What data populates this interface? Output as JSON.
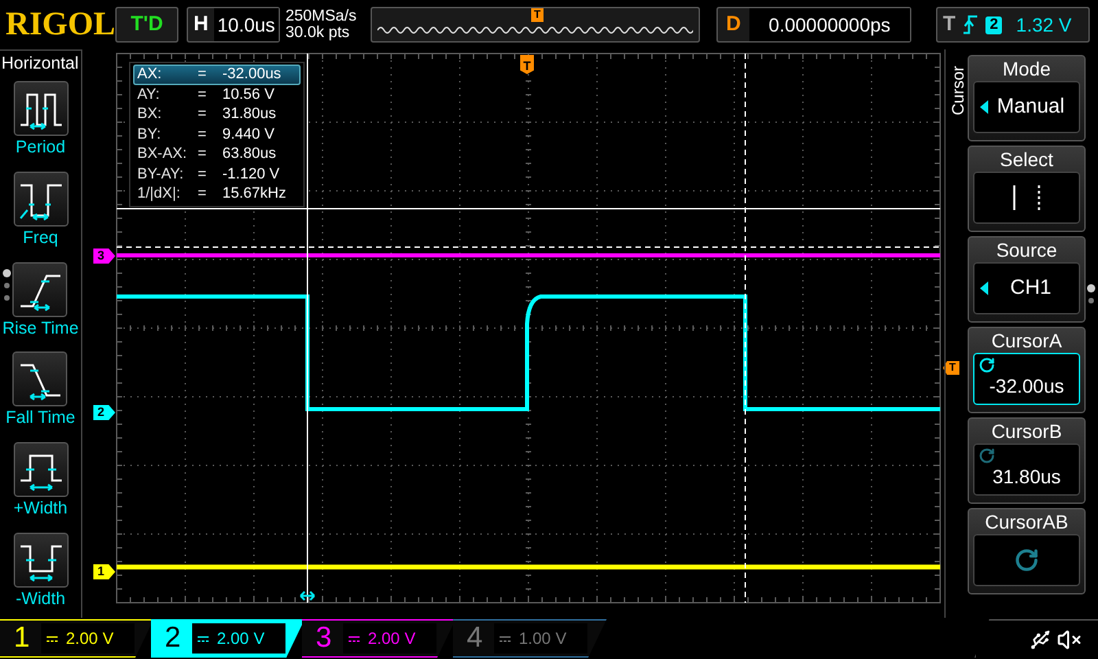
{
  "logo": "RIGOL",
  "run_status": "T'D",
  "horizontal": {
    "label": "H",
    "timebase": "10.0us"
  },
  "acquisition": {
    "sample_rate": "250MSa/s",
    "memory_depth": "30.0k pts"
  },
  "overview": {
    "trigger_marker": "T"
  },
  "delay": {
    "label": "D",
    "value": "0.00000000ps"
  },
  "trigger": {
    "label": "T",
    "source": "2",
    "level": "1.32 V"
  },
  "left_menu": {
    "title": "Horizontal",
    "items": [
      {
        "kind": "period",
        "label": "Period"
      },
      {
        "kind": "freq",
        "label": "Freq"
      },
      {
        "kind": "rise",
        "label": "Rise Time"
      },
      {
        "kind": "fall",
        "label": "Fall Time"
      },
      {
        "kind": "pwidth",
        "label": "+Width"
      },
      {
        "kind": "nwidth",
        "label": "-Width"
      }
    ]
  },
  "cursor_readout": [
    {
      "label": "AX:",
      "separator": "=",
      "value": "-32.00us",
      "selected": true
    },
    {
      "label": "AY:",
      "separator": "=",
      "value": "10.56 V",
      "selected": false
    },
    {
      "label": "BX:",
      "separator": "=",
      "value": "31.80us",
      "selected": false
    },
    {
      "label": "BY:",
      "separator": "=",
      "value": "9.440 V",
      "selected": false
    },
    {
      "label": "BX-AX:",
      "separator": "=",
      "value": "63.80us",
      "selected": false
    },
    {
      "label": "BY-AY:",
      "separator": "=",
      "value": "-1.120 V",
      "selected": false
    },
    {
      "label": "1/|dX|:",
      "separator": "=",
      "value": "15.67kHz",
      "selected": false
    }
  ],
  "trigger_markers": {
    "top": "T",
    "level": "T"
  },
  "channel_markers": [
    {
      "label": "3",
      "color": "#ff00ff"
    },
    {
      "label": "2",
      "color": "#00ffff"
    },
    {
      "label": "1",
      "color": "#ffff00"
    }
  ],
  "right_menu": {
    "title": "Cursor",
    "items": [
      {
        "kind": "dropdown",
        "title": "Mode",
        "value": "Manual",
        "selected": false
      },
      {
        "kind": "select",
        "title": "Select",
        "selected": false
      },
      {
        "kind": "dropdown",
        "title": "Source",
        "value": "CH1",
        "selected": false
      },
      {
        "kind": "knob",
        "title": "CursorA",
        "value": "-32.00us",
        "selected": true
      },
      {
        "kind": "knob",
        "title": "CursorB",
        "value": "31.80us",
        "selected": false
      },
      {
        "kind": "knob",
        "title": "CursorAB",
        "selected": false
      }
    ]
  },
  "channels": [
    {
      "label": "1",
      "scale": "2.00 V",
      "color": "#ffff00",
      "selected": false,
      "on": true
    },
    {
      "label": "2",
      "scale": "2.00 V",
      "color": "#00ffff",
      "selected": true,
      "on": true
    },
    {
      "label": "3",
      "scale": "2.00 V",
      "color": "#ff00ff",
      "selected": false,
      "on": true
    },
    {
      "label": "4",
      "scale": "1.00 V",
      "color": "#3070a0",
      "selected": false,
      "on": false
    }
  ]
}
